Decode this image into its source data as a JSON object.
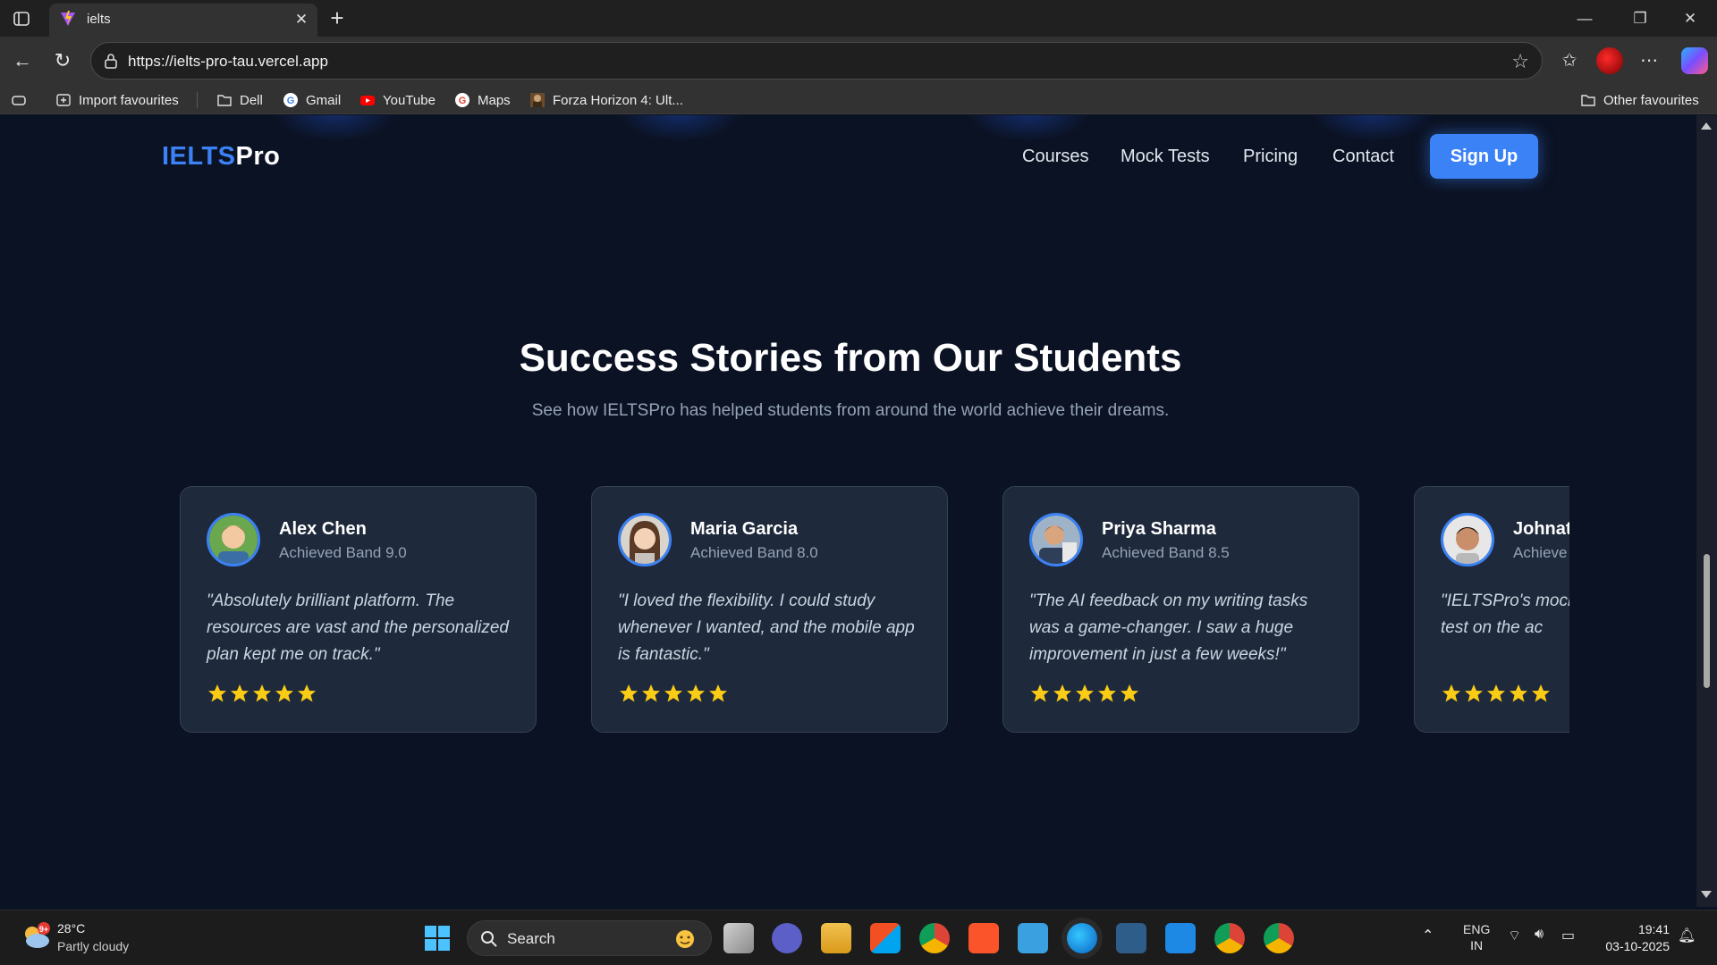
{
  "browser": {
    "tab_title": "ielts",
    "url": "https://ielts-pro-tau.vercel.app",
    "bookmarks": [
      {
        "label": "Import favourites",
        "icon": "import-icon"
      },
      {
        "label": "Dell",
        "icon": "folder-icon"
      },
      {
        "label": "Gmail",
        "icon": "google-icon"
      },
      {
        "label": "YouTube",
        "icon": "youtube-icon"
      },
      {
        "label": "Maps",
        "icon": "google-icon"
      },
      {
        "label": "Forza Horizon 4: Ult...",
        "icon": "game-thumbnail-icon"
      }
    ],
    "other_favourites": "Other favourites"
  },
  "site": {
    "logo_part1": "IELTS",
    "logo_part2": "Pro",
    "nav": [
      "Courses",
      "Mock Tests",
      "Pricing",
      "Contact"
    ],
    "signup_label": "Sign Up"
  },
  "section": {
    "title": "Success Stories from Our Students",
    "subtitle": "See how IELTSPro has helped students from around the world achieve their dreams."
  },
  "testimonials": [
    {
      "name": "Alex Chen",
      "band": "Achieved Band 9.0",
      "quote": "\"Absolutely brilliant platform. The resources are vast and the personalized plan kept me on track.\"",
      "stars": 5
    },
    {
      "name": "Maria Garcia",
      "band": "Achieved Band 8.0",
      "quote": "\"I loved the flexibility. I could study whenever I wanted, and the mobile app is fantastic.\"",
      "stars": 5
    },
    {
      "name": "Priya Sharma",
      "band": "Achieved Band 8.5",
      "quote": "\"The AI feedback on my writing tasks was a game-changer. I saw a huge improvement in just a few weeks!\"",
      "stars": 5
    },
    {
      "name": "Johnat",
      "band": "Achieve",
      "quote": "\"IELTSPro's mock realistic. It felt lik the test on the ac",
      "stars": 5
    }
  ],
  "taskbar": {
    "weather_badge": "9+",
    "temperature": "28°C",
    "weather": "Partly cloudy",
    "search_label": "Search",
    "language": "ENG",
    "region": "IN",
    "time": "19:41",
    "date": "03-10-2025"
  },
  "colors": {
    "page_bg": "#0b1223",
    "card_bg": "#1e293b",
    "accent": "#3b82f6",
    "star": "#facc15"
  }
}
